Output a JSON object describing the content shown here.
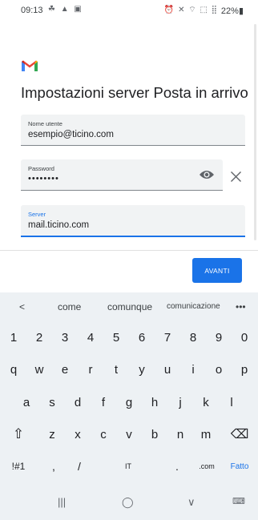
{
  "status_bar": {
    "time": "09:13",
    "left_icons": "☘ ▲ ▣",
    "right_icons": "⏰ ✕ ⌔ ⬚ ⣿",
    "battery": "22%▮"
  },
  "screen": {
    "title": "Impostazioni server Posta in arrivo",
    "username": {
      "label": "Nome utente",
      "value": "esempio@ticino.com"
    },
    "password": {
      "label": "Password",
      "value": "••••••••"
    },
    "server": {
      "label": "Server",
      "value": "mail.ticino.com"
    },
    "next_button": "AVANTI"
  },
  "keyboard": {
    "suggestions": [
      "<",
      "come",
      "comunque",
      "comunicazione",
      "•••"
    ],
    "row_numbers": [
      "1",
      "2",
      "3",
      "4",
      "5",
      "6",
      "7",
      "8",
      "9",
      "0"
    ],
    "row_qwerty": [
      "q",
      "w",
      "e",
      "r",
      "t",
      "y",
      "u",
      "i",
      "o",
      "p"
    ],
    "row_asdf": [
      "a",
      "s",
      "d",
      "f",
      "g",
      "h",
      "j",
      "k",
      "l"
    ],
    "row_zxcv": [
      "⇧",
      "z",
      "x",
      "c",
      "v",
      "b",
      "n",
      "m",
      "⌫"
    ],
    "row_bottom": [
      "!#1",
      ",",
      "/",
      "IT",
      ".",
      ".com",
      "Fatto"
    ]
  },
  "nav_bar": {
    "recents": "|||",
    "home": "◯",
    "back": "∨",
    "keyboard": "⌨"
  },
  "colors": {
    "accent": "#1a73e8",
    "field_bg": "#f1f3f4",
    "keyboard_bg": "#edf1f4"
  }
}
